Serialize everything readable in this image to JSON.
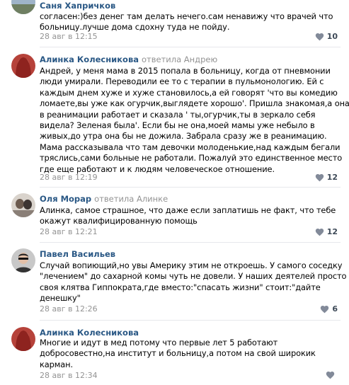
{
  "comments": [
    {
      "author": "Саня Хапричков",
      "reply_to": "",
      "lines": [
        "согласен:)без денег там делать нечего.сам ненавижу что врачей что",
        "больницу.лучше дома сдохну туда не пойду."
      ],
      "date": "28 авг в 12:15",
      "likes": "10",
      "avatar_icon": "avatar-photo-icon"
    },
    {
      "author": "Алинка Колесникова",
      "reply_to": "ответила Андрею",
      "lines": [
        "Андрей, у меня мама в 2015 попала в больницу, когда от пневмонии",
        "люди умирали. Переводили ее то с терапии в пульмонологию. Ей с",
        "каждым днем хуже и хуже становилось,а ей говорят 'что вы комедию",
        "ломаете,вы уже как огурчик,выглядете хорошо'. Пришла знакомая,а она",
        "в реанимации работает и сказала ' ты,огурчик,ты в зеркало себя",
        "видела? Зеленая была'. Если бы не она,моей мамы уже небыло в",
        "живых,до утра она бы не дожила. Забрала сразу же в реанимацию.",
        "Мама рассказывала что там девочки молоденькие,над каждым бегали",
        "тряслись,сами больные не работали. Пожалуй это единственное место",
        "где еще работают и к людям человеческое отношение."
      ],
      "date": "28 авг в 12:19",
      "likes": "12",
      "avatar_icon": "avatar-photo-icon"
    },
    {
      "author": "Оля Морар",
      "reply_to": "ответила Алинке",
      "lines": [
        "Алинка, самое страшное, что даже если заплатишь не факт, что тебе",
        "окажут квалифицированную помощь"
      ],
      "date": "28 авг в 12:21",
      "likes": "12",
      "avatar_icon": "avatar-photo-icon"
    },
    {
      "author": "Павел Васильев",
      "reply_to": "",
      "lines": [
        "Случай вопиющий,но увы Америку этим не откроешь. У самого соседку",
        "\"лечением\" до сахарной комы чуть не довели. У наших деятелей просто",
        "своя клятва Гиппократа,где вместо:\"спасать жизни\" стоит:\"дайте",
        "денешку\""
      ],
      "date": "28 авг в 12:26",
      "likes": "6",
      "avatar_icon": "avatar-photo-icon"
    },
    {
      "author": "Алинка Колесникова",
      "reply_to": "",
      "lines": [
        "Многие и идут в мед потому что первые лет 5 работают",
        "добросовестно,на институт и больницу,а потом на свой широкик",
        "карман."
      ],
      "date": "28 авг в 12:34",
      "likes": "",
      "avatar_icon": "avatar-photo-icon"
    }
  ],
  "colors": {
    "author": "#2a5885",
    "meta": "#939393",
    "heart": "#828a99",
    "divider": "#e7e8ec"
  }
}
